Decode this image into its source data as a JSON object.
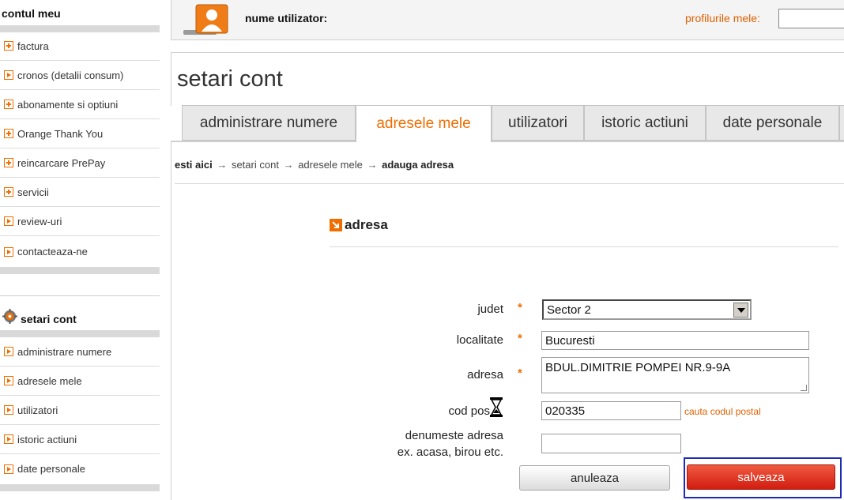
{
  "sidebar": {
    "account_title": "contul meu",
    "account_items": [
      {
        "label": "factura",
        "icon": "plus-box-icon"
      },
      {
        "label": "cronos (detalii consum)",
        "icon": "arrow-box-icon"
      },
      {
        "label": "abonamente si optiuni",
        "icon": "plus-box-icon"
      },
      {
        "label": "Orange Thank You",
        "icon": "plus-box-icon"
      },
      {
        "label": "reincarcare PrePay",
        "icon": "plus-box-icon"
      },
      {
        "label": "servicii",
        "icon": "plus-box-icon"
      },
      {
        "label": "review-uri",
        "icon": "arrow-box-icon"
      },
      {
        "label": "contacteaza-ne",
        "icon": "arrow-box-icon"
      }
    ],
    "settings_title": "setari cont",
    "settings_items": [
      {
        "label": "administrare numere",
        "icon": "arrow-box-icon"
      },
      {
        "label": "adresele mele",
        "icon": "arrow-box-icon"
      },
      {
        "label": "utilizatori",
        "icon": "arrow-box-icon"
      },
      {
        "label": "istoric actiuni",
        "icon": "arrow-box-icon"
      },
      {
        "label": "date personale",
        "icon": "arrow-box-icon"
      }
    ]
  },
  "header": {
    "user_label": "nume utilizator:",
    "user_value": " ",
    "profiles_label": "profilurile mele:",
    "profiles_value": ""
  },
  "page": {
    "title": "setari cont",
    "tabs": [
      {
        "label": "administrare numere",
        "active": false
      },
      {
        "label": "adresele mele",
        "active": true
      },
      {
        "label": "utilizatori",
        "active": false
      },
      {
        "label": "istoric actiuni",
        "active": false
      },
      {
        "label": "date personale",
        "active": false
      }
    ],
    "breadcrumb": {
      "here": "esti aici",
      "sep": "→",
      "level1": "setari cont",
      "level2": "adresele mele",
      "current": "adauga adresa"
    }
  },
  "form": {
    "section_title": "adresa",
    "required_mark": "*",
    "judet": {
      "label": "judet",
      "value": "Sector 2"
    },
    "localitate": {
      "label": "localitate",
      "value": "Bucuresti"
    },
    "adresa": {
      "label": "adresa",
      "value": "BDUL.DIMITRIE POMPEI NR.9-9A"
    },
    "cod_postal": {
      "label": "cod pos",
      "value": "020335",
      "lookup_link": "cauta codul postal"
    },
    "denumire": {
      "label_line1": "denumeste adresa",
      "label_line2": "ex. acasa, birou etc.",
      "value": ""
    },
    "cancel_label": "anuleaza",
    "save_label": "salveaza"
  },
  "colors": {
    "accent": "#f06e00",
    "save_button": "#d11d10",
    "highlight_frame": "#1c2bb5"
  }
}
